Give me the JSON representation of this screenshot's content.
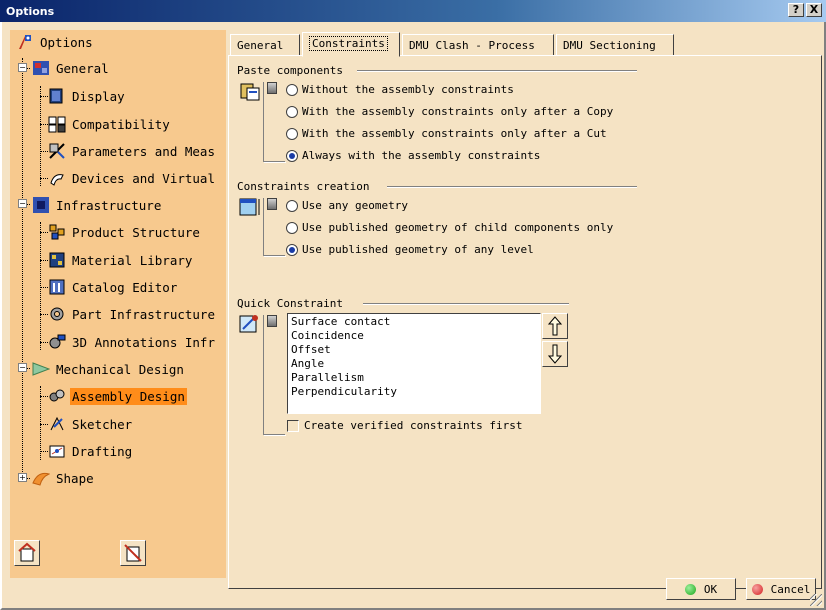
{
  "window": {
    "title": "Options",
    "help_label": "?",
    "close_label": "X"
  },
  "tree": {
    "items": [
      {
        "label": "Options",
        "icon": "options-icon",
        "level": 0
      },
      {
        "label": "General",
        "icon": "general-icon",
        "level": 1
      },
      {
        "label": "Display",
        "icon": "display-icon",
        "level": 2
      },
      {
        "label": "Compatibility",
        "icon": "compatibility-icon",
        "level": 2
      },
      {
        "label": "Parameters and Meas",
        "icon": "parameters-icon",
        "level": 2
      },
      {
        "label": "Devices and Virtual",
        "icon": "devices-icon",
        "level": 2
      },
      {
        "label": "Infrastructure",
        "icon": "infrastructure-icon",
        "level": 1
      },
      {
        "label": "Product Structure",
        "icon": "product-structure-icon",
        "level": 2
      },
      {
        "label": "Material Library",
        "icon": "material-library-icon",
        "level": 2
      },
      {
        "label": "Catalog Editor",
        "icon": "catalog-editor-icon",
        "level": 2
      },
      {
        "label": "Part Infrastructure",
        "icon": "part-infrastructure-icon",
        "level": 2
      },
      {
        "label": "3D Annotations Infr",
        "icon": "annotations-icon",
        "level": 2
      },
      {
        "label": "Mechanical Design",
        "icon": "mechanical-design-icon",
        "level": 1
      },
      {
        "label": "Assembly Design",
        "icon": "assembly-design-icon",
        "level": 2,
        "selected": true
      },
      {
        "label": "Sketcher",
        "icon": "sketcher-icon",
        "level": 2
      },
      {
        "label": "Drafting",
        "icon": "drafting-icon",
        "level": 2
      },
      {
        "label": "Shape",
        "icon": "shape-icon",
        "level": 1
      }
    ]
  },
  "tabs": [
    {
      "label": "General"
    },
    {
      "label": "Constraints",
      "active": true
    },
    {
      "label": "DMU Clash - Process"
    },
    {
      "label": "DMU Sectioning"
    }
  ],
  "paste_components": {
    "title": "Paste components",
    "options": [
      {
        "label": "Without the assembly constraints",
        "selected": false
      },
      {
        "label": "With the assembly constraints only after a Copy",
        "selected": false
      },
      {
        "label": "With the assembly constraints only after a Cut",
        "selected": false
      },
      {
        "label": "Always with the assembly constraints",
        "selected": true
      }
    ]
  },
  "constraints_creation": {
    "title": "Constraints creation",
    "options": [
      {
        "label": "Use any geometry",
        "selected": false
      },
      {
        "label": "Use published geometry of child components only",
        "selected": false
      },
      {
        "label": "Use published geometry of any level",
        "selected": true
      }
    ]
  },
  "quick_constraint": {
    "title": "Quick Constraint",
    "items": [
      "Surface contact",
      "Coincidence",
      "Offset",
      "Angle",
      "Parallelism",
      "Perpendicularity"
    ],
    "checkbox_label": "Create verified constraints first",
    "checkbox_checked": false
  },
  "buttons": {
    "ok": "OK",
    "cancel": "Cancel"
  },
  "colors": {
    "selection": "#ff8c1a",
    "tree_bg": "#f7c98e",
    "dialog_bg": "#f5e3c4",
    "ok_dot": "#1aa61a",
    "cancel_dot": "#d42020"
  }
}
